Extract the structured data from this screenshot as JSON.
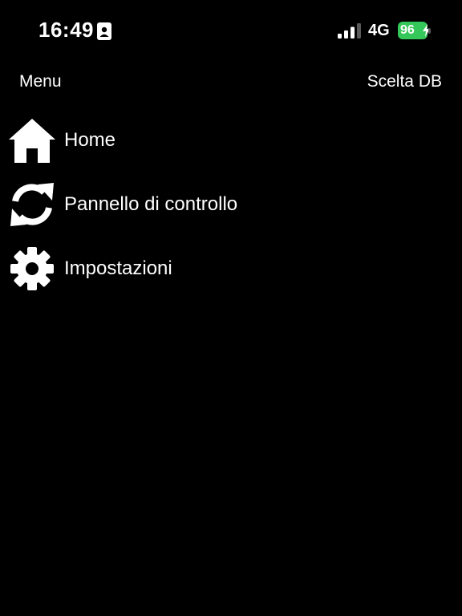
{
  "status_bar": {
    "time": "16:49",
    "network": "4G",
    "battery_level": "96",
    "battery_color": "#34c759",
    "icons": [
      "contact-card-icon",
      "signal-bars-icon",
      "battery-icon",
      "charging-bolt-icon"
    ]
  },
  "header": {
    "title": "Menu",
    "db_button_label": "Scelta DB"
  },
  "menu": {
    "items": [
      {
        "label": "Home",
        "icon": "home-icon"
      },
      {
        "label": "Pannello di controllo",
        "icon": "refresh-icon"
      },
      {
        "label": "Impostazioni",
        "icon": "gear-icon"
      }
    ]
  },
  "colors": {
    "background": "#000000",
    "text": "#ffffff"
  }
}
